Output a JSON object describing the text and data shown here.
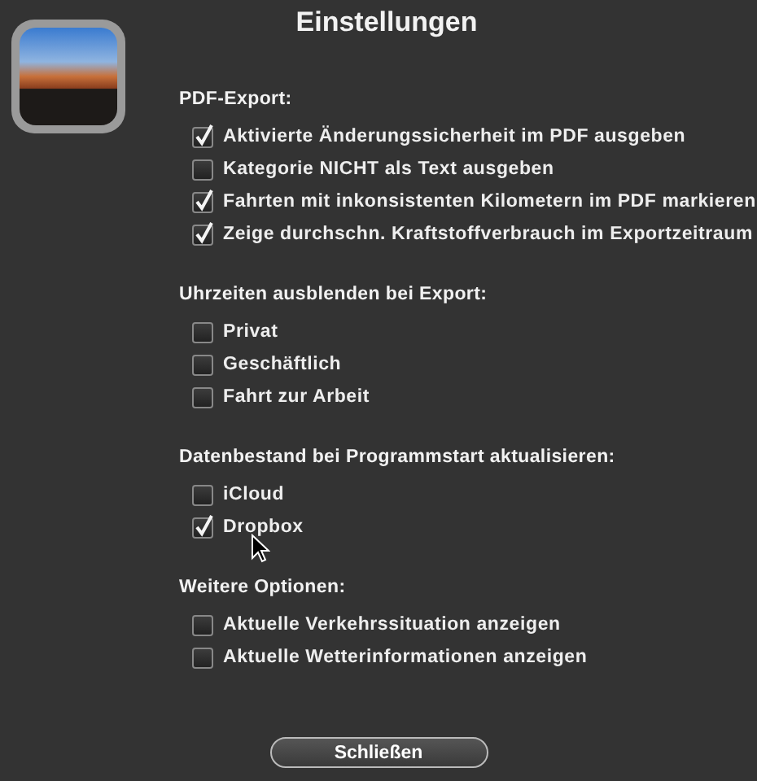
{
  "window": {
    "title": "Einstellungen"
  },
  "sections": [
    {
      "title": "PDF-Export:",
      "options": [
        {
          "label": "Aktivierte Änderungssicherheit im PDF ausgeben",
          "checked": true
        },
        {
          "label": "Kategorie NICHT als Text ausgeben",
          "checked": false
        },
        {
          "label": "Fahrten mit inkonsistenten Kilometern im PDF markieren",
          "checked": true
        },
        {
          "label": "Zeige durchschn. Kraftstoffverbrauch im Exportzeitraum",
          "checked": true
        }
      ]
    },
    {
      "title": "Uhrzeiten ausblenden bei Export:",
      "options": [
        {
          "label": "Privat",
          "checked": false
        },
        {
          "label": "Geschäftlich",
          "checked": false
        },
        {
          "label": "Fahrt zur Arbeit",
          "checked": false
        }
      ]
    },
    {
      "title": "Datenbestand bei Programmstart aktualisieren:",
      "options": [
        {
          "label": "iCloud",
          "checked": false
        },
        {
          "label": "Dropbox",
          "checked": true
        }
      ]
    },
    {
      "title": "Weitere Optionen:",
      "options": [
        {
          "label": "Aktuelle Verkehrssituation anzeigen",
          "checked": false
        },
        {
          "label": "Aktuelle Wetterinformationen anzeigen",
          "checked": false
        }
      ]
    }
  ],
  "close_button": "Schließen"
}
